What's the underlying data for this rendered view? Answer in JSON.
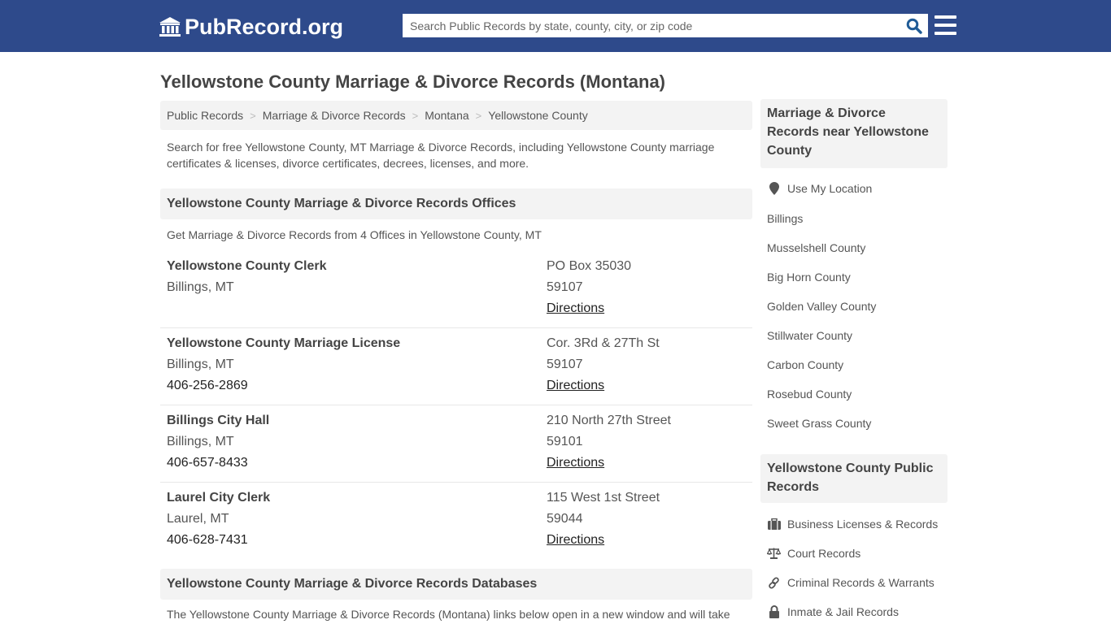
{
  "header": {
    "logo_text": "PubRecord.org",
    "search_placeholder": "Search Public Records by state, county, city, or zip code",
    "search_value": "",
    "brand_color": "#2e4a8b",
    "search_icon_color": "#1f5b96"
  },
  "page": {
    "title": "Yellowstone County Marriage & Divorce Records (Montana)",
    "breadcrumb": [
      "Public Records",
      "Marriage & Divorce Records",
      "Montana",
      "Yellowstone County"
    ],
    "intro": "Search for free Yellowstone County, MT Marriage & Divorce Records, including Yellowstone County marriage certificates & licenses, divorce certificates, decrees, licenses, and more."
  },
  "offices_section": {
    "heading": "Yellowstone County Marriage & Divorce Records Offices",
    "subtext": "Get Marriage & Divorce Records from 4 Offices in Yellowstone County, MT",
    "offices": [
      {
        "name": "Yellowstone County Clerk",
        "city": "Billings, MT",
        "phone": "",
        "address": "PO Box 35030",
        "zip": "59107",
        "directions": "Directions"
      },
      {
        "name": "Yellowstone County Marriage License",
        "city": "Billings, MT",
        "phone": "406-256-2869",
        "address": "Cor. 3Rd & 27Th St",
        "zip": "59107",
        "directions": "Directions"
      },
      {
        "name": "Billings City Hall",
        "city": "Billings, MT",
        "phone": "406-657-8433",
        "address": "210 North 27th Street",
        "zip": "59101",
        "directions": "Directions"
      },
      {
        "name": "Laurel City Clerk",
        "city": "Laurel, MT",
        "phone": "406-628-7431",
        "address": "115 West 1st Street",
        "zip": "59044",
        "directions": "Directions"
      }
    ]
  },
  "databases_section": {
    "heading": "Yellowstone County Marriage & Divorce Records Databases",
    "text": "The Yellowstone County Marriage & Divorce Records (Montana) links below open in a new window and will take"
  },
  "sidebar": {
    "nearby_heading": "Marriage & Divorce Records near Yellowstone County",
    "use_location": "Use My Location",
    "nearby": [
      "Billings",
      "Musselshell County",
      "Big Horn County",
      "Golden Valley County",
      "Stillwater County",
      "Carbon County",
      "Rosebud County",
      "Sweet Grass County"
    ],
    "public_heading": "Yellowstone County Public Records",
    "public_records": [
      {
        "label": "Business Licenses & Records",
        "icon": "briefcase-icon"
      },
      {
        "label": "Court Records",
        "icon": "scales-icon"
      },
      {
        "label": "Criminal Records & Warrants",
        "icon": "link-icon"
      },
      {
        "label": "Inmate & Jail Records",
        "icon": "lock-icon"
      }
    ]
  }
}
